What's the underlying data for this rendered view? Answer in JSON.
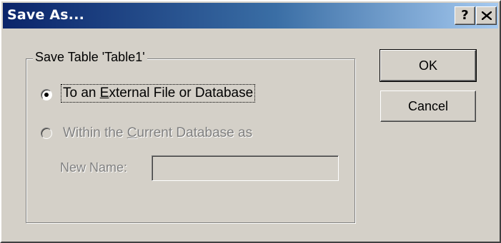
{
  "window": {
    "title": "Save As...",
    "help_label": "?",
    "colors": {
      "titlebar_start": "#0a246a",
      "titlebar_end": "#a6caf0",
      "face": "#d4d0c8",
      "disabled_text": "#808080"
    }
  },
  "group": {
    "legend": "Save Table 'Table1'"
  },
  "options": [
    {
      "pre": "To an ",
      "accel": "E",
      "post": "xternal File or Database",
      "selected": true,
      "enabled": true
    },
    {
      "pre": "Within the ",
      "accel": "C",
      "post": "urrent Database as",
      "selected": false,
      "enabled": false
    }
  ],
  "new_name": {
    "label": "New Name:",
    "value": ""
  },
  "buttons": {
    "ok": "OK",
    "cancel": "Cancel"
  },
  "icons": {
    "help": "question-mark-icon",
    "close": "close-x-icon"
  }
}
